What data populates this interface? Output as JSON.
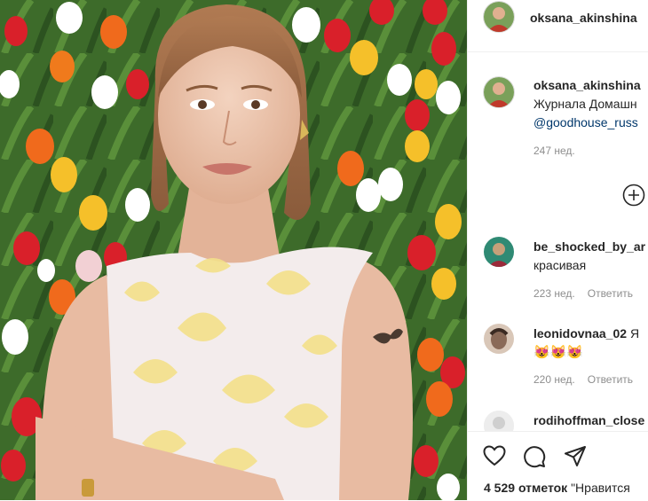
{
  "post_author": {
    "username": "oksana_akinshina",
    "avatar_icon": "profile-avatar-icon"
  },
  "caption": {
    "username": "oksana_akinshina",
    "text_line1": "Журнала Домашн",
    "link": "@goodhouse_russ",
    "time": "247 нед."
  },
  "comments": [
    {
      "username": "be_shocked_by_ar",
      "text": "красивая",
      "time": "223 нед.",
      "reply": "Ответить"
    },
    {
      "username": "leonidovnaa_02",
      "text_suffix": "Я",
      "emojis": "😻😻😻",
      "time": "220 нед.",
      "reply": "Ответить"
    },
    {
      "username": "rodihoffman_close"
    }
  ],
  "actions": {
    "like_icon": "heart-icon",
    "comment_icon": "comment-icon",
    "share_icon": "share-icon",
    "add_icon": "plus-circle-icon"
  },
  "likes": {
    "count": "4 529",
    "label": "отметок",
    "suffix": "\"Нравится"
  },
  "colors": {
    "link": "#00376b",
    "muted": "#8e8e8e",
    "border": "#efefef"
  }
}
